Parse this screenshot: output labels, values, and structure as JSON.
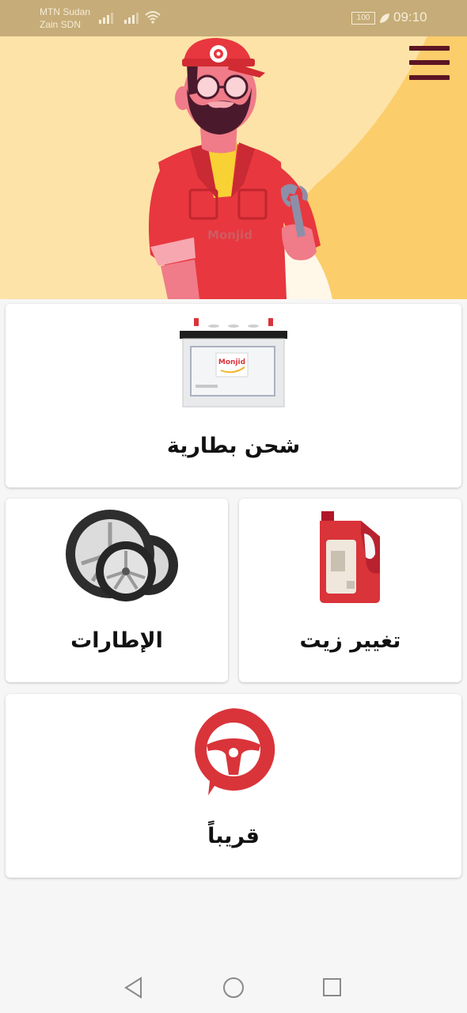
{
  "status_bar": {
    "carrier_1": "MTN Sudan",
    "carrier_2": "Zain SDN",
    "battery": "100",
    "time": "09:10"
  },
  "hero": {
    "logo_text": "Monjid"
  },
  "services": {
    "battery": {
      "label": "شحن بطارية",
      "brand": "Monjid",
      "icon": "car-battery-icon"
    },
    "tires": {
      "label": "الإطارات",
      "icon": "tires-icon"
    },
    "oil": {
      "label": "تغيير زيت",
      "icon": "oil-can-icon"
    },
    "soon": {
      "label": "قريباً",
      "icon": "steering-wheel-icon"
    }
  },
  "colors": {
    "accent_red": "#d9343a",
    "hero_bg": "#fde3a7",
    "hero_circle": "#fbcd6b",
    "menu": "#5c1424"
  }
}
